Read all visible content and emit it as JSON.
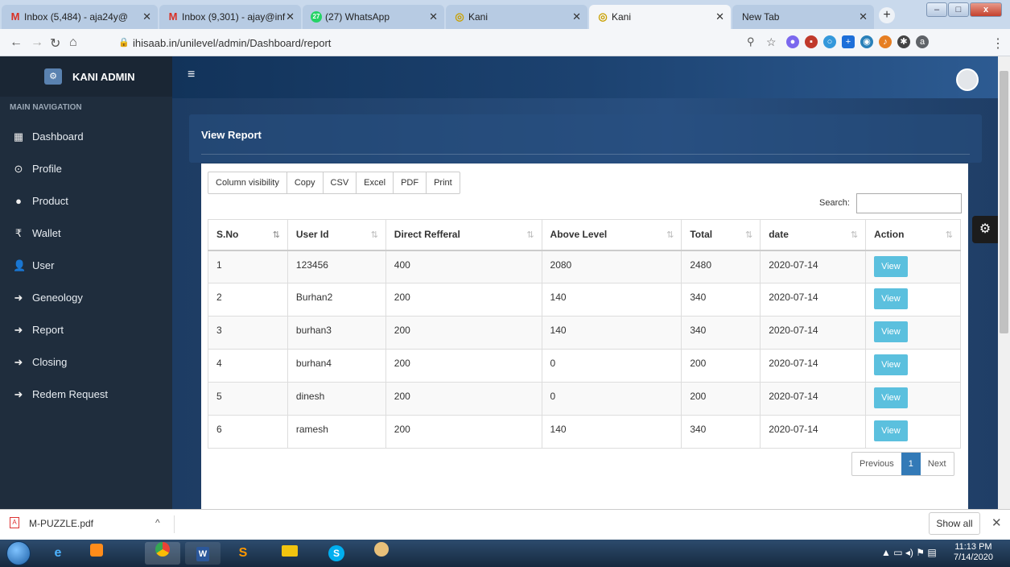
{
  "browser": {
    "tabs": [
      {
        "label": "Inbox (5,484) - aja24y@",
        "icon": "gmail-icon"
      },
      {
        "label": "Inbox (9,301) - ajay@inf",
        "icon": "gmail-icon"
      },
      {
        "label": "(27) WhatsApp",
        "icon": "whatsapp-icon"
      },
      {
        "label": "Kani",
        "icon": "kani-icon"
      },
      {
        "label": "Kani",
        "icon": "kani-icon"
      },
      {
        "label": "New Tab",
        "icon": ""
      }
    ],
    "url": "ihisaab.in/unilevel/admin/Dashboard/report"
  },
  "sidebar": {
    "brand": "KANI ADMIN",
    "header": "MAIN NAVIGATION",
    "items": [
      {
        "label": "Dashboard",
        "icon": "dashboard-icon",
        "glyph": "▦"
      },
      {
        "label": "Profile",
        "icon": "profile-icon",
        "glyph": "⊙"
      },
      {
        "label": "Product",
        "icon": "product-icon",
        "glyph": "●"
      },
      {
        "label": "Wallet",
        "icon": "rupee-icon",
        "glyph": "₹"
      },
      {
        "label": "User",
        "icon": "user-icon",
        "glyph": "👤"
      },
      {
        "label": "Geneology",
        "icon": "arrow-right-icon",
        "glyph": "➜"
      },
      {
        "label": "Report",
        "icon": "arrow-right-icon",
        "glyph": "➜"
      },
      {
        "label": "Closing",
        "icon": "arrow-right-icon",
        "glyph": "➜"
      },
      {
        "label": "Redem Request",
        "icon": "arrow-right-icon",
        "glyph": "➜"
      }
    ]
  },
  "main": {
    "title": "View Report",
    "buttons": [
      "Column visibility",
      "Copy",
      "CSV",
      "Excel",
      "PDF",
      "Print"
    ],
    "search_label": "Search:",
    "search_value": "",
    "columns": [
      "S.No",
      "User Id",
      "Direct Refferal",
      "Above Level",
      "Total",
      "date",
      "Action"
    ],
    "rows": [
      [
        "1",
        "123456",
        "400",
        "2080",
        "2480",
        "2020-07-14"
      ],
      [
        "2",
        "Burhan2",
        "200",
        "140",
        "340",
        "2020-07-14"
      ],
      [
        "3",
        "burhan3",
        "200",
        "140",
        "340",
        "2020-07-14"
      ],
      [
        "4",
        "burhan4",
        "200",
        "0",
        "200",
        "2020-07-14"
      ],
      [
        "5",
        "dinesh",
        "200",
        "0",
        "200",
        "2020-07-14"
      ],
      [
        "6",
        "ramesh",
        "200",
        "140",
        "340",
        "2020-07-14"
      ]
    ],
    "action_label": "View",
    "pagination": {
      "previous": "Previous",
      "page": "1",
      "next": "Next"
    }
  },
  "download_bar": {
    "file": "M-PUZZLE.pdf",
    "show_all": "Show all"
  },
  "taskbar": {
    "time": "11:13 PM",
    "date": "7/14/2020"
  },
  "colors": {
    "sidebar_bg": "#1f2d3d",
    "view_button": "#5bc0de",
    "pagination_active": "#337ab7"
  }
}
